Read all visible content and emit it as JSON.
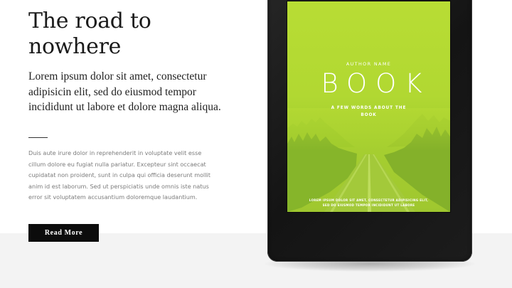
{
  "hero": {
    "headline": "The road to nowhere",
    "lede": "Lorem ipsum dolor sit amet, consectetur adipisicin elit, sed do eiusmod tempor incididunt ut labore et dolore magna aliqua.",
    "body": "Duis aute irure dolor in reprehenderit in voluptate velit esse cillum dolore eu fugiat nulla pariatur. Excepteur sint occaecat cupidatat non proident, sunt in culpa qui officia deserunt mollit anim id est laborum. Sed ut perspiciatis unde omnis iste natus error sit voluptatem accusantium doloremque laudantium.",
    "cta_label": "Read More"
  },
  "book_cover": {
    "author": "AUTHOR NAME",
    "title": "BOOK",
    "tagline": "A FEW WORDS ABOUT THE BOOK",
    "blurb": "LOREM IPSUM DOLOR SIT AMET, CONSECTETUR ADIPISICING ELIT, SED DO EIUSMOD TEMPOR INCIDIDUNT UT LABORE"
  },
  "colors": {
    "cover_green": "#b5db33",
    "button_bg": "#0c0c0c",
    "band_bg": "#f3f3f3"
  }
}
